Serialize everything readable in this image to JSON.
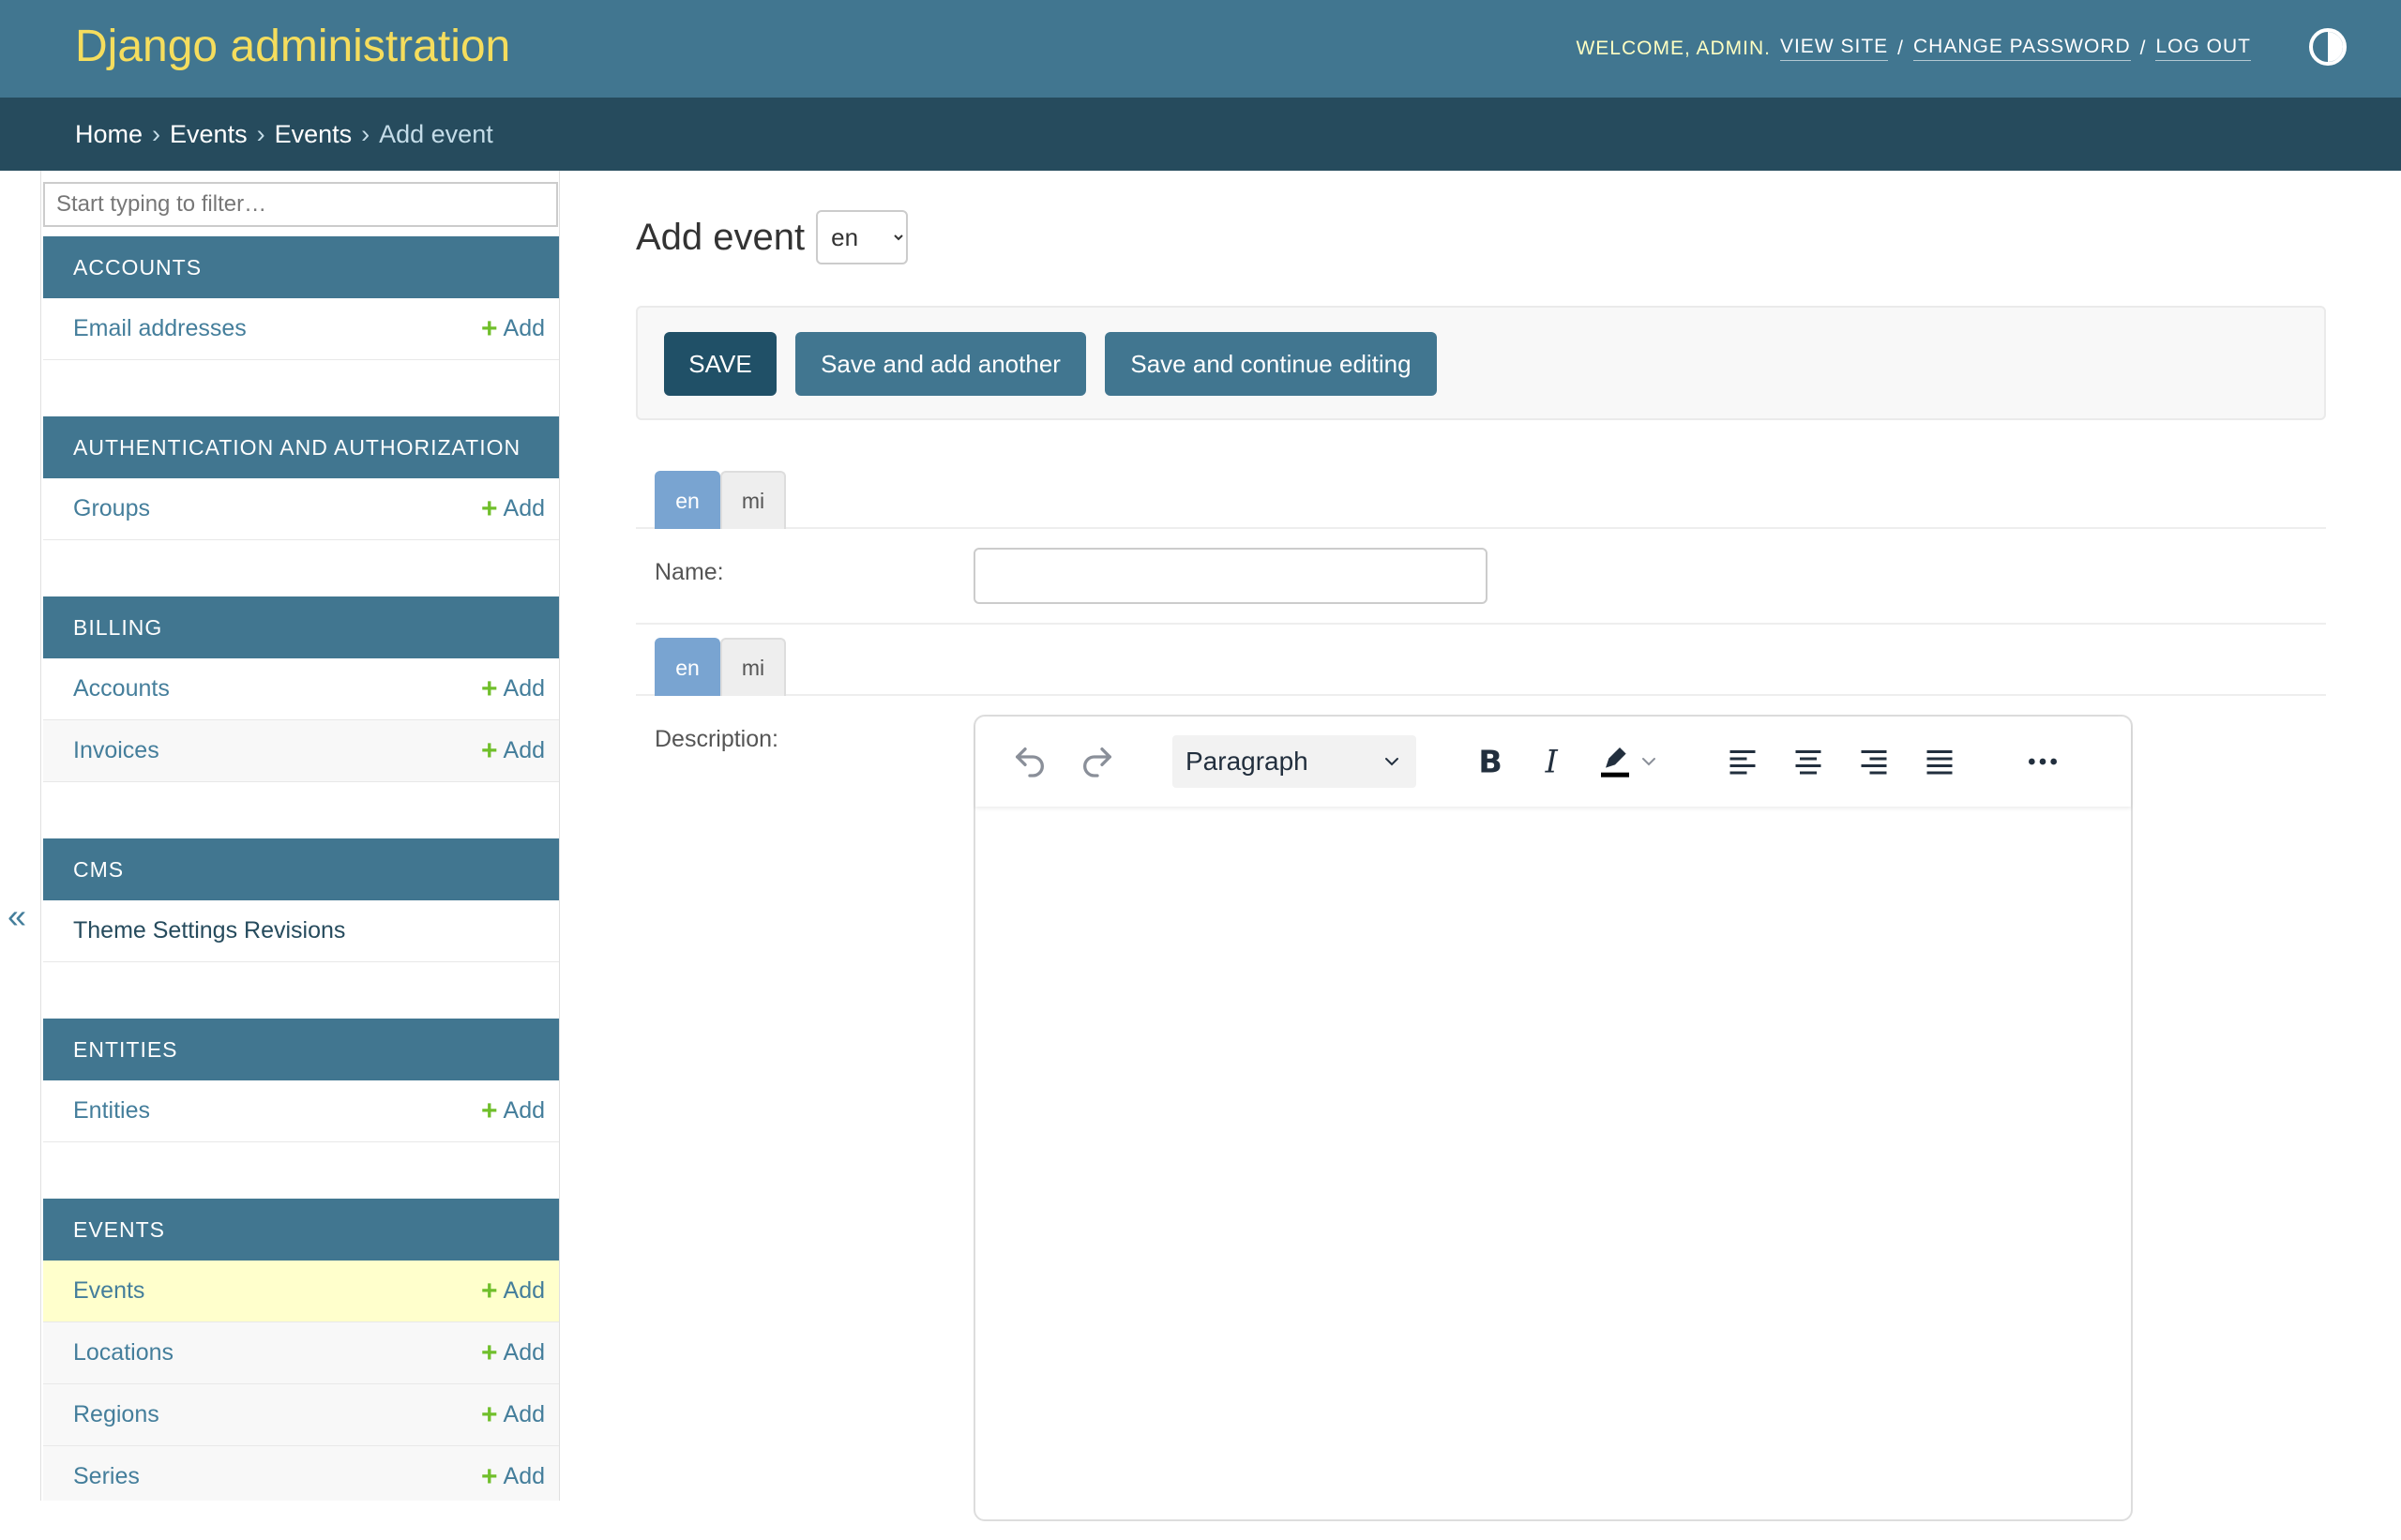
{
  "header": {
    "brand": "Django administration",
    "welcome": "Welcome, admin.",
    "view_site": "View site",
    "change_password": "Change password",
    "log_out": "Log out",
    "separator": "/"
  },
  "breadcrumbs": {
    "items": [
      "Home",
      "Events",
      "Events"
    ],
    "current": "Add event",
    "separator": "›"
  },
  "sidebar": {
    "filter_placeholder": "Start typing to filter…",
    "collapse_glyph": "«",
    "add_label": "Add",
    "modules": [
      {
        "caption": "ACCOUNTS",
        "models": [
          {
            "name": "Email addresses",
            "has_add": true
          }
        ]
      },
      {
        "caption": "AUTHENTICATION AND AUTHORIZATION",
        "models": [
          {
            "name": "Groups",
            "has_add": true
          }
        ]
      },
      {
        "caption": "BILLING",
        "models": [
          {
            "name": "Accounts",
            "has_add": true
          },
          {
            "name": "Invoices",
            "has_add": true
          }
        ]
      },
      {
        "caption": "CMS",
        "models": [
          {
            "name": "Theme Settings Revisions",
            "has_add": false
          }
        ]
      },
      {
        "caption": "ENTITIES",
        "models": [
          {
            "name": "Entities",
            "has_add": true
          }
        ]
      },
      {
        "caption": "EVENTS",
        "models": [
          {
            "name": "Events",
            "has_add": true
          },
          {
            "name": "Locations",
            "has_add": true
          },
          {
            "name": "Regions",
            "has_add": true
          },
          {
            "name": "Series",
            "has_add": true
          }
        ]
      }
    ]
  },
  "content": {
    "title": "Add event",
    "language_selected": "en",
    "buttons": {
      "save": "Save",
      "save_add_another": "Save and add another",
      "save_continue": "Save and continue editing"
    },
    "tabs": [
      "en",
      "mi"
    ],
    "name_label": "Name:",
    "description_label": "Description:",
    "editor": {
      "block_format": "Paragraph"
    }
  },
  "colors": {
    "header_bg": "#417690",
    "breadcrumb_bg": "#264b5d",
    "brand": "#f5dd5d",
    "add_plus": "#70bf2b",
    "current_row": "#ffffcc",
    "active_tab": "#79a4d1"
  }
}
